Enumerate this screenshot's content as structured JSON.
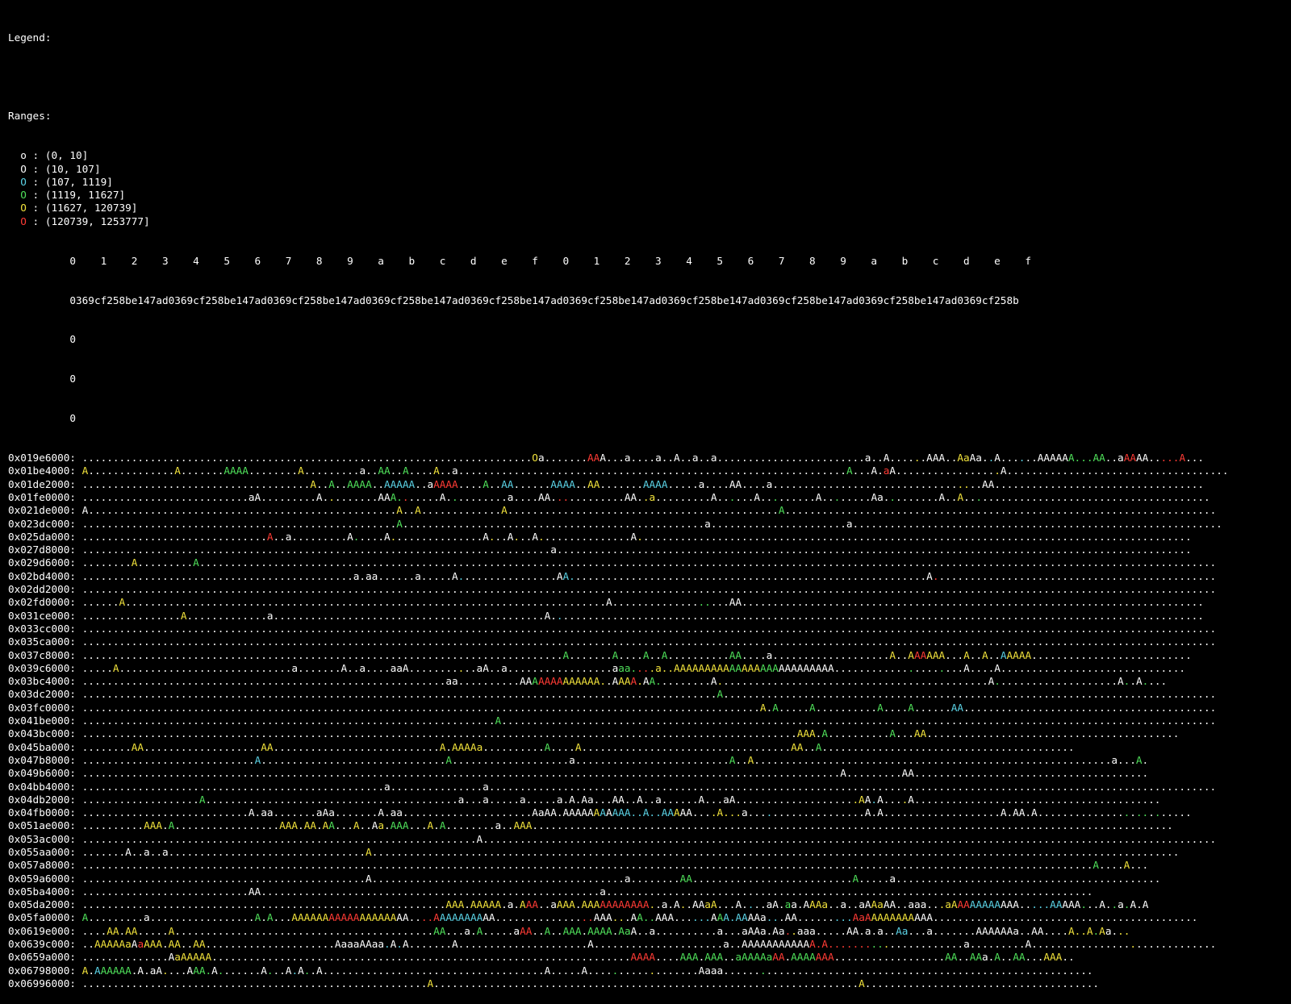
{
  "legend": {
    "title": "Legend:",
    "ranges_title": "Ranges:",
    "ranges": [
      {
        "symbol": "o",
        "text": " : (0, 10]",
        "color": "#ffffff"
      },
      {
        "symbol": "O",
        "text": " : (10, 107]",
        "color": "#ffffff"
      },
      {
        "symbol": "O",
        "text": " : (107, 1119]",
        "color": "#5bd3e6"
      },
      {
        "symbol": "O",
        "text": " : (1119, 11627]",
        "color": "#4fe05a"
      },
      {
        "symbol": "O",
        "text": " : (11627, 120739]",
        "color": "#f2e33c"
      },
      {
        "symbol": "O",
        "text": " : (120739, 1253777]",
        "color": "#ff3b35"
      }
    ]
  },
  "header": {
    "row1": "          0    1    2    3    4    5    6    7    8    9    a    b    c    d    e    f    0    1    2    3    4    5    6    7    8    9    a    b    c    d    e    f",
    "row2": "          0369cf258be147ad0369cf258be147ad0369cf258be147ad0369cf258be147ad0369cf258be147ad0369cf258be147ad0369cf258be147ad0369cf258be147ad0369cf258be147ad0369cf258b",
    "row3": "          0",
    "row4": "          0",
    "row5": "          0"
  },
  "colors": {
    "Y": "#f2e33c",
    "G": "#4fe05a",
    "C": "#5bd3e6",
    "R": "#ff3b35"
  },
  "rows": [
    {
      "addr": "0x019e6000:",
      "cells": ".........................................................................Oa.......AAA...a....a..A..a..a........................a..A......AAA..AaAa..A......AAAAAA...AA..aAAAA.....A...",
      "colors": ".........................................................................Y........RR...................................................Y......YY...C....C.......GGGGGG...RR....RRRR.....G..."
    },
    {
      "addr": "0x01be4000:",
      "cells": "A..............A.......AAAA........A.........a..AA..A....A..a...............................................................A...A.aA.................A....................................",
      "colors": "Y..............Y.......GGGG........Y............GG..G....Y..................................................................G.....R.................Y...................................."
    },
    {
      "addr": "0x01de2000:",
      "cells": ".....................................A..A..AAAA..AAAAA..aAAAA....A..AA......AAAA..AA.......AAAA.....a....AA....a..................................AA..................................",
      "colors": ".....................................Y..G..GGGG..CCCCC...RRRR....G..CC......CCCC..YY.......CCCC...............................................YY.................................."
    },
    {
      "addr": "0x01fe0000:",
      "cells": "...........................aA.........A.........AAA.......A..........a....AA............AA..a.........A......A.........A........Aa.........A..A........................................",
      "colors": "........................................Y.........GGR.......G................RR............YY............G......G.........G........G..........Y..G........................................"
    },
    {
      "addr": "0x021de000:",
      "cells": "A..................................................A..A.............A............................................A......................................................................",
      "colors": "...................................................Y..Y.............Y............................................G......................................................................"
    },
    {
      "addr": "0x023dc000:",
      "cells": "...................................................A.................................................a......................a............................................................",
      "colors": "...................................................G................................................................................................................................"
    },
    {
      "addr": "0x025da000:",
      "cells": "..............................A..a.........A.....A...............A...A...A...............A..........................................................................................",
      "colors": "..............................R.............G.....Y...............Y...Y...Y...............Y.........................................................................................."
    },
    {
      "addr": "0x027d8000:",
      "cells": "............................................................................a.......................................................................................................",
      "colors": "........................................................................................................................................................................................"
    },
    {
      "addr": "0x029d6000:",
      "cells": "........A.........A.....................................................................................................................................................................",
      "colors": "........Y.........G....................................................................................................................................................................."
    },
    {
      "addr": "0x02bd4000:",
      "cells": "............................................a.aa......a.....A................AA..........................................................A..............................................",
      "colors": ".............................................................C................CC..........................................................R.............................................."
    },
    {
      "addr": "0x02dd2000:",
      "cells": "........................................................................................................................................................................................",
      "colors": "........................................................................................................................................................................................"
    },
    {
      "addr": "0x02fd0000:",
      "cells": "......A..............................................................................A...................AA...........................................................................",
      "colors": "......Y.............................................................................................GG..........................................................................."
    },
    {
      "addr": "0x031ce000:",
      "cells": "................A.............a............................................A..........................................................................................................",
      "colors": "................Y............................................................C.........................................................................................................."
    },
    {
      "addr": "0x033cc000:",
      "cells": "........................................................................................................................................................................................",
      "colors": "........................................................................................................................................................................................"
    },
    {
      "addr": "0x035ca000:",
      "cells": "........................................................................................................................................................................................",
      "colors": "........................................................................................................................................................................................"
    },
    {
      "addr": "0x037c8000:",
      "cells": "..............................................................................A.......A....A..A..........AA....a...................A..AAAAAA...A..A..AAAAA..........................",
      "colors": "..............................................................................G.......G....G..G..........GG........................Y..YRRYYY...Y..Y..CYYYY.........................."
    },
    {
      "addr": "0x039c6000:",
      "cells": ".....A............................a.......A..a....aaA...........aA..a.................aaa....a..AAAAAAAAAAAAAAAAAAAAAAAAAA.....................A....A..............................",
      "colors": ".....Y.......................................................Y.........................GGGRRYYYYYYYYYYYYYGGYYYGGG.....................G....G..............................."
    },
    {
      "addr": "0x03bc4000:",
      "cells": "...........................................................aa..........AAAAAAAAAAAAA..AAAA.AA.........A............................................A....................A..A....",
      "colors": ".........................................................................GRRRRYYYYYYY..YYRY.GG.........Y............................................G....................G..G...."
    },
    {
      "addr": "0x03dc2000:",
      "cells": ".......................................................................................................A................................................................................",
      "colors": ".......................................................................................................G................................................................................"
    },
    {
      "addr": "0x03fc0000:",
      "cells": "..............................................................................................................A.A.....A..........A....A......AA.........................................",
      "colors": "..............................................................................................................Y.G.....G..........G....G......CC........................................."
    },
    {
      "addr": "0x041be000:",
      "cells": "...................................................................A....................................................................................................................",
      "colors": "...................................................................G...................................................................................................................."
    },
    {
      "addr": "0x043bc000:",
      "cells": "....................................................................................................................AAA.A..........A...AA.........................................",
      "colors": "....................................................................................................................YYY.G..........G...YY........................................."
    },
    {
      "addr": "0x045ba000:",
      "cells": "........AA...................AA...........................A.AAAAa..........A....A..................................AA..A.........................................",
      "colors": "........YY...................YY...........................Y.YYYYY..........G....Y..................................YY..G........................................."
    },
    {
      "addr": "0x047b8000:",
      "cells": "............................A..............................A...................a.........................A..A..........................................................a...A.",
      "colors": "............................C..............................G.............................................G..Y..........................................................a...G."
    },
    {
      "addr": "0x049b6000:",
      "cells": "...........................................................................................................................A.........AA......................................",
      "colors": "........................................................................................................................................................................................"
    },
    {
      "addr": "0x04bb4000:",
      "cells": ".................................................a...............a......................................................................................................................",
      "colors": "........................................................................................................................................................................................"
    },
    {
      "addr": "0x04db2000:",
      "cells": "...................A.........................................a...a.....a.....a.A.Aa...AA..A..a......A...aA....................AA.A....A........................................",
      "colors": "...................G.........................................................................................................YY.C....Y........................................"
    },
    {
      "addr": "0x04fb0000:",
      "cells": "...........................A.aa.......aAa.......A.aa.....................AaAA.AAAAAAAAAAA..A..AAAAA....A...a...................A.A...................A.AA.A.........................",
      "colors": "...................................................................................YC.CCCCCCCCCCY.....YYYYY....C.........................................................G.GG.G........................."
    },
    {
      "addr": "0x051ae000:",
      "cells": "..........AAA.A.................AAA.AA.AA...A..Aa.AAA...A.A........a..AAA........................................................................................................",
      "colors": "..........YYY.G.................YYY.YY.YG...Y...Y.GGG...Y.G...........YYY........................................................................................................"
    },
    {
      "addr": "0x053ac000:",
      "cells": "................................................................A.......................................................................................................................",
      "colors": "........................................................................................................................................................................................"
    },
    {
      "addr": "0x055aa000:",
      "cells": ".......A..a..a................................A...................................................................................................................................",
      "colors": "..............................................Y..................................................................................................................................."
    },
    {
      "addr": "0x057a8000:",
      "cells": "....................................................................................................................................................................A....A...",
      "colors": "....................................................................................................................................................................G....Y..."
    },
    {
      "addr": "0x059a6000:",
      "cells": "..............................................A.........................................a........AA..........................A.....a...........................................",
      "colors": ".................................................................................................GG..........................G.........................................................."
    },
    {
      "addr": "0x05ba4000:",
      "cells": "...........................AA.......................................................a...............................................................................",
      "colors": "........................................................................................................................................................................................"
    },
    {
      "addr": "0x05da2000:",
      "cells": "...........................................................AAA.AAAAA.a.AAA..aAAA.AAAAAAAAAAA..a.A..AAaA...A....aA.aa.AAAa..a..aAAaAA..aaa...aAAAAAAAAAAA.....AAAAA...A..a.A.A",
      "colors": "...........................................................YYY.YYYYY...YRR...YYY.YYYRRRRRRRRY....Y...YY.....C.....G...YYY.......YY.........YYYRRCCCCC.....CCCCC...G....G.G"
    },
    {
      "addr": "0x05fa0000:",
      "cells": "A.........a.................A.A...AAAAAAAAAAAAAAAAAAA....AAAAAAAAAA................AAA...AA..AAA......AAA.AAAAa...AA.........AaAAAAAAAAAAA...........................................",
      "colors": "G...........................G.G...YYYYYYRRRRRYYYYYY....RRRCCCCCCC................RR...YY..GGG......CCC.GCCCC...CC.........CCCRRRYYYYYYY..........................................."
    },
    {
      "addr": "0x0619e000:",
      "cells": "....AA.AA.....A..........................................AA...a.A.....aAA..A..AAA.AAAA.AaA..a..........a...aAAa.Aa..aaa.....AA.a.a..Aa...a.......AAAAAAa..AA....A..A.Aa...",
      "colors": "....YY.YY.....Y..........................................GG.....G......RR..G..GGG.GGGG.GG.........................RY................CC..........................YYYYGY..YY....Y..R.R...."
    },
    {
      "addr": "0x0639c000:",
      "cells": "..AAAAAaAaAAA.AA..AA.....................AaaaAAaa.A.A.......A.....................A.....................a..AAAAAAAAAAAA.A......................a.........A..............................",
      "colors": "..YYYYYY.RYYY.YY..YY.............................C.C..................................................................RRRRRRRRRRGGY.......................................Y.............................."
    },
    {
      "addr": "0x0659a000:",
      "cells": "..............AaAAAAA....................................................................AAAA....AAA.AAA..aAAAAaAA.AAAAAAA..................AA..AAa.A..AA...AAA..",
      "colors": "...............YYYYYY....................................................................RRRR....GGG.GGG..GGGGGGRR.GGGGRRR..................GG..GG..G..GG...YYY.."
    },
    {
      "addr": "0x06798000:",
      "cells": "A.AAAAAA.A.aA....AAA.A.......A...A.A..A....................................A.....A..................Aaaa............................................................",
      "colors": "Y.CGGGGG.....Y....GGG.G.......G...C.G.................................................G.....Y.................G............................................................"
    },
    {
      "addr": "0x06996000:",
      "cells": "........................................................A.....................................................................A......................................",
      "colors": "........................................................Y.....................................................................Y......................................"
    }
  ]
}
